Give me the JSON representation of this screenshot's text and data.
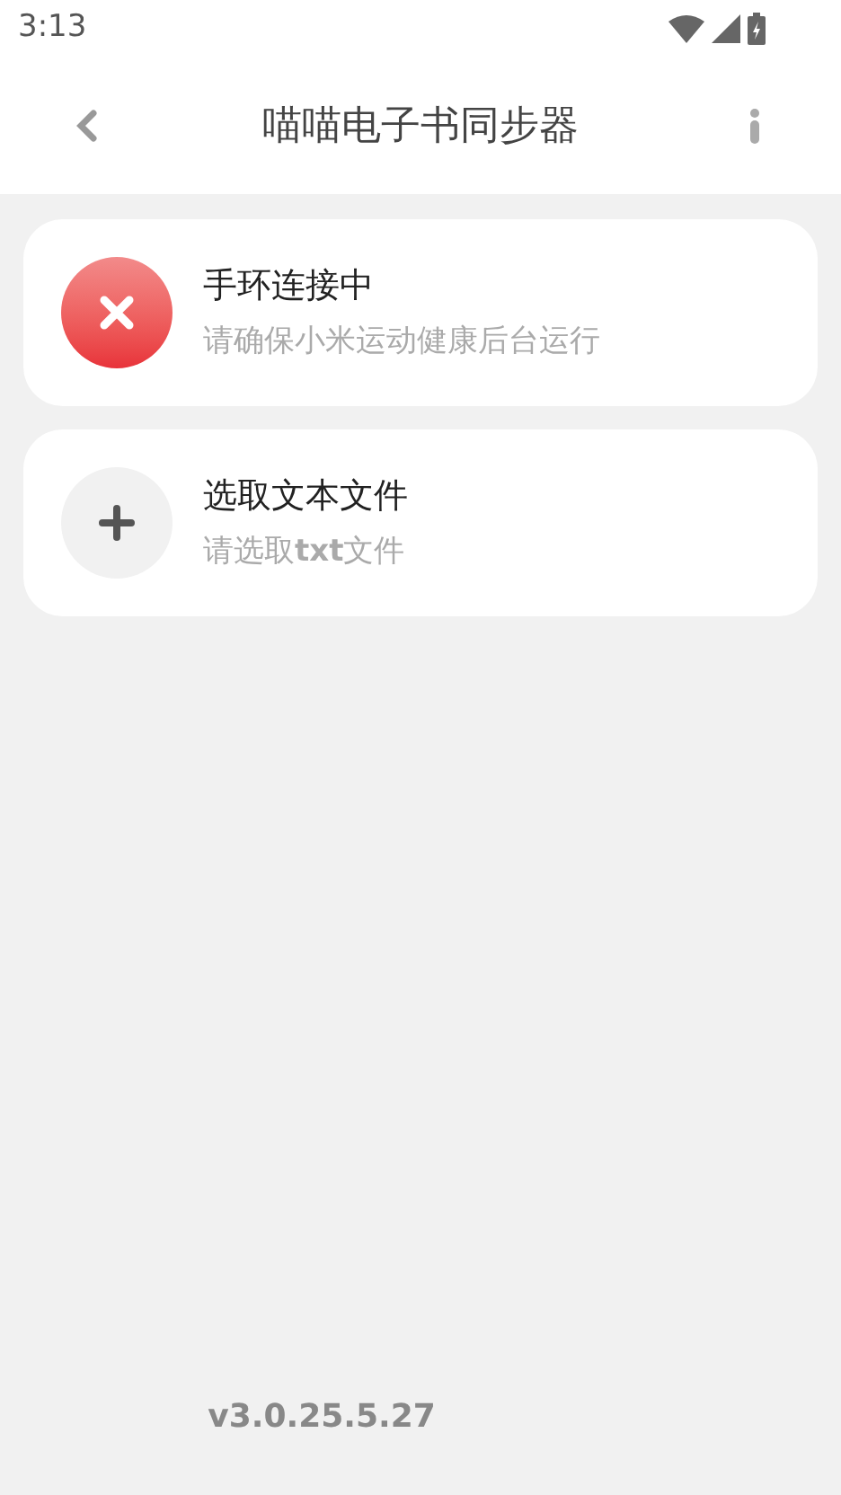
{
  "status_bar": {
    "time": "3:13"
  },
  "header": {
    "title": "喵喵电子书同步器"
  },
  "cards": [
    {
      "kind": "error",
      "title": "手环连接中",
      "subtitle": "请确保小米运动健康后台运行"
    },
    {
      "kind": "add",
      "title": "选取文本文件",
      "subtitle": "请选取**txt**文件"
    }
  ],
  "footer": {
    "version": "v3.0.25.5.27"
  }
}
